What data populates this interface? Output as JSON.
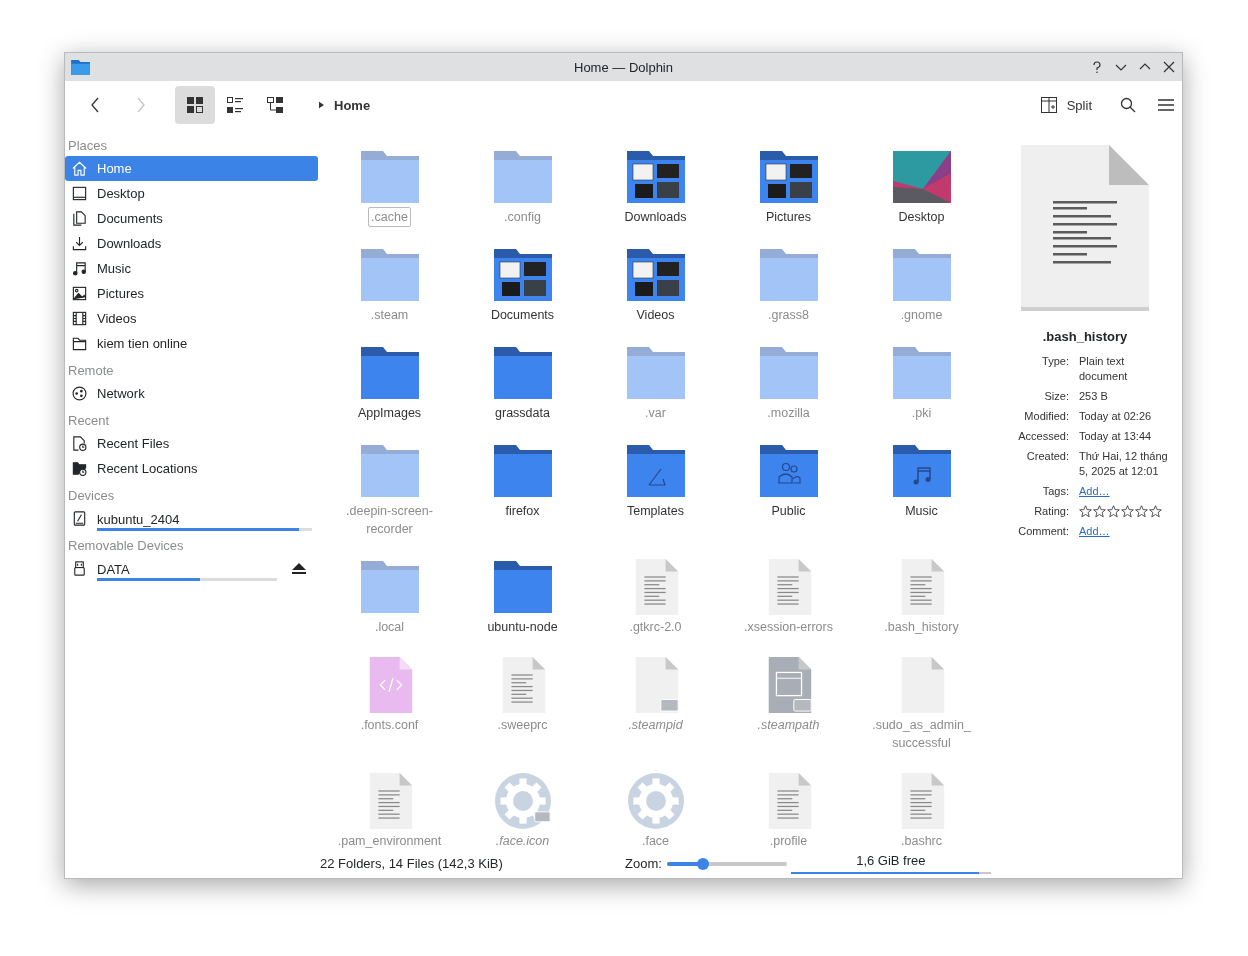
{
  "window": {
    "title": "Home — Dolphin"
  },
  "toolbar": {
    "nav": [
      {
        "kind": "back",
        "disabled": false
      },
      {
        "kind": "forward",
        "disabled": true
      }
    ],
    "view_modes": [
      {
        "kind": "icons",
        "selected": true
      },
      {
        "kind": "compact",
        "selected": false
      },
      {
        "kind": "details",
        "selected": false
      }
    ],
    "breadcrumb": "Home",
    "split_label": "Split"
  },
  "sidebar": [
    {
      "heading": "Places",
      "items": [
        {
          "label": "Home",
          "kind": "home",
          "selected": true
        },
        {
          "label": "Desktop",
          "kind": "desktop",
          "selected": false
        },
        {
          "label": "Documents",
          "kind": "documents",
          "selected": false
        },
        {
          "label": "Downloads",
          "kind": "downloads",
          "selected": false
        },
        {
          "label": "Music",
          "kind": "music",
          "selected": false
        },
        {
          "label": "Pictures",
          "kind": "pictures",
          "selected": false
        },
        {
          "label": "Videos",
          "kind": "videos",
          "selected": false
        },
        {
          "label": "kiem tien online",
          "kind": "folder",
          "selected": false
        }
      ]
    },
    {
      "heading": "Remote",
      "items": [
        {
          "label": "Network",
          "kind": "network",
          "selected": false
        }
      ]
    },
    {
      "heading": "Recent",
      "items": [
        {
          "label": "Recent Files",
          "kind": "recentfiles",
          "selected": false
        },
        {
          "label": "Recent Locations",
          "kind": "recentlocations",
          "selected": false
        }
      ]
    },
    {
      "heading": "Devices",
      "items": [
        {
          "label": "kubuntu_2404",
          "kind": "drive",
          "selected": false,
          "level": 0.94
        }
      ]
    },
    {
      "heading": "Removable Devices",
      "items": [
        {
          "label": "DATA",
          "kind": "usb",
          "selected": false,
          "level": 0.57,
          "ejectable": true
        }
      ]
    }
  ],
  "files": [
    {
      "name": ".cache",
      "kind": "folder",
      "hidden": true,
      "link": false,
      "focused": true
    },
    {
      "name": ".config",
      "kind": "folder",
      "hidden": true,
      "link": false,
      "focused": false
    },
    {
      "name": "Downloads",
      "kind": "preview",
      "hidden": false,
      "link": false,
      "focused": false
    },
    {
      "name": "Pictures",
      "kind": "preview",
      "hidden": false,
      "link": false,
      "focused": false
    },
    {
      "name": "Desktop",
      "kind": "wallpaper",
      "hidden": false,
      "link": false,
      "focused": false
    },
    {
      "name": ".steam",
      "kind": "folder",
      "hidden": true,
      "link": false,
      "focused": false
    },
    {
      "name": "Documents",
      "kind": "preview",
      "hidden": false,
      "link": false,
      "focused": false
    },
    {
      "name": "Videos",
      "kind": "preview",
      "hidden": false,
      "link": false,
      "focused": false
    },
    {
      "name": ".grass8",
      "kind": "folder",
      "hidden": true,
      "link": false,
      "focused": false
    },
    {
      "name": ".gnome",
      "kind": "folder",
      "hidden": true,
      "link": false,
      "focused": false
    },
    {
      "name": "AppImages",
      "kind": "folder",
      "hidden": false,
      "link": false,
      "focused": false
    },
    {
      "name": "grassdata",
      "kind": "folder",
      "hidden": false,
      "link": false,
      "focused": false
    },
    {
      "name": ".var",
      "kind": "folder",
      "hidden": true,
      "link": false,
      "focused": false
    },
    {
      "name": ".mozilla",
      "kind": "folder",
      "hidden": true,
      "link": false,
      "focused": false
    },
    {
      "name": ".pki",
      "kind": "folder",
      "hidden": true,
      "link": false,
      "focused": false
    },
    {
      "name": ".deepin-screen-recorder",
      "kind": "folder",
      "hidden": true,
      "link": false,
      "focused": false
    },
    {
      "name": "firefox",
      "kind": "folder",
      "hidden": false,
      "link": false,
      "focused": false
    },
    {
      "name": "Templates",
      "kind": "templates",
      "hidden": false,
      "link": false,
      "focused": false
    },
    {
      "name": "Public",
      "kind": "public",
      "hidden": false,
      "link": false,
      "focused": false
    },
    {
      "name": "Music",
      "kind": "music",
      "hidden": false,
      "link": false,
      "focused": false
    },
    {
      "name": ".local",
      "kind": "folder",
      "hidden": true,
      "link": false,
      "focused": false
    },
    {
      "name": "ubuntu-node",
      "kind": "folder",
      "hidden": false,
      "link": false,
      "focused": false
    },
    {
      "name": ".gtkrc-2.0",
      "kind": "text",
      "hidden": true,
      "link": false,
      "focused": false
    },
    {
      "name": ".xsession-errors",
      "kind": "text",
      "hidden": true,
      "link": false,
      "focused": false
    },
    {
      "name": ".bash_history",
      "kind": "text",
      "hidden": true,
      "link": false,
      "focused": false
    },
    {
      "name": ".fonts.conf",
      "kind": "code",
      "hidden": true,
      "link": false,
      "focused": false
    },
    {
      "name": ".sweeprc",
      "kind": "text",
      "hidden": true,
      "link": false,
      "focused": false
    },
    {
      "name": ".steampid",
      "kind": "blank",
      "hidden": true,
      "link": true,
      "focused": false
    },
    {
      "name": ".steampath",
      "kind": "unknown",
      "hidden": true,
      "link": true,
      "focused": false
    },
    {
      "name": ".sudo_as_admin_successful",
      "kind": "blank",
      "hidden": true,
      "link": false,
      "focused": false
    },
    {
      "name": ".pam_environment",
      "kind": "text",
      "hidden": true,
      "link": false,
      "focused": false
    },
    {
      "name": ".face.icon",
      "kind": "gear",
      "hidden": true,
      "link": true,
      "focused": false
    },
    {
      "name": ".face",
      "kind": "gear",
      "hidden": true,
      "link": false,
      "focused": false
    },
    {
      "name": ".profile",
      "kind": "text",
      "hidden": true,
      "link": false,
      "focused": false
    },
    {
      "name": ".bashrc",
      "kind": "text",
      "hidden": true,
      "link": false,
      "focused": false
    }
  ],
  "info_panel": {
    "name": ".bash_history",
    "fields": [
      {
        "kind": "text",
        "label": "Type:",
        "value": "Plain text document"
      },
      {
        "kind": "text",
        "label": "Size:",
        "value": "253 B"
      },
      {
        "kind": "text",
        "label": "Modified:",
        "value": "Today at 02:26"
      },
      {
        "kind": "text",
        "label": "Accessed:",
        "value": "Today at 13:44"
      },
      {
        "kind": "text",
        "label": "Created:",
        "value": "Thứ Hai, 12 tháng 5, 2025 at 12:01"
      },
      {
        "kind": "link",
        "label": "Tags:",
        "value": "Add…"
      },
      {
        "kind": "rating",
        "label": "Rating:",
        "stars": 0
      },
      {
        "kind": "link",
        "label": "Comment:",
        "value": "Add…"
      }
    ]
  },
  "status_bar": {
    "summary": "22 Folders, 14 Files (142,3 KiB)",
    "zoom_label": "Zoom:",
    "zoom": {
      "level": 0.3
    },
    "free_space": {
      "text": "1,6 GiB free",
      "level": 0.94
    }
  }
}
